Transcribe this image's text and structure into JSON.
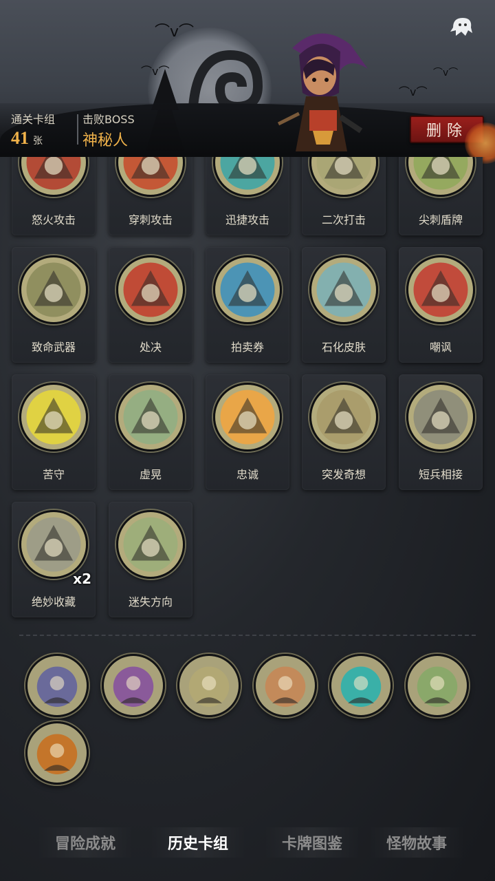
{
  "header": {
    "cleared_deck_label": "通关卡组",
    "card_count": "41",
    "card_unit": "张",
    "defeated_boss_label": "击败BOSS",
    "boss_name": "神秘人",
    "delete_label": "删除",
    "ghost_icon": "ghost-icon"
  },
  "cards": [
    {
      "name": "怒火攻击",
      "icon": "rage-axe-art",
      "color": "#b33a2a"
    },
    {
      "name": "穿刺攻击",
      "icon": "pierce-spikes-art",
      "color": "#c7492a"
    },
    {
      "name": "迅捷攻击",
      "icon": "swift-axe-art",
      "color": "#3aa5a8"
    },
    {
      "name": "二次打击",
      "icon": "double-dagger-art",
      "color": "#a8a474"
    },
    {
      "name": "尖刺盾牌",
      "icon": "spike-shield-art",
      "color": "#8fa85a"
    },
    {
      "name": "致命武器",
      "icon": "deadly-weapons-art",
      "color": "#8a8a5a"
    },
    {
      "name": "处决",
      "icon": "execute-art",
      "color": "#c23a2a"
    },
    {
      "name": "拍卖券",
      "icon": "auction-gavel-art",
      "color": "#3a8fc0"
    },
    {
      "name": "石化皮肤",
      "icon": "stone-skin-art",
      "color": "#7ab0b8"
    },
    {
      "name": "嘲讽",
      "icon": "taunt-art",
      "color": "#c33a30"
    },
    {
      "name": "苦守",
      "icon": "endure-shield-art",
      "color": "#e8d83a"
    },
    {
      "name": "虚晃",
      "icon": "feint-boxer-art",
      "color": "#8fae84"
    },
    {
      "name": "忠诚",
      "icon": "loyalty-cross-art",
      "color": "#f2a440"
    },
    {
      "name": "突发奇想",
      "icon": "sudden-idea-art",
      "color": "#a89a6a"
    },
    {
      "name": "短兵相接",
      "icon": "close-combat-art",
      "color": "#8a8a7a"
    },
    {
      "name": "绝妙收藏",
      "icon": "collection-art",
      "color": "#9a9a8a",
      "count": "x2"
    },
    {
      "name": "迷失方向",
      "icon": "lost-signpost-art",
      "color": "#9aae7a"
    }
  ],
  "relics": [
    {
      "icon": "witch-cat-icon",
      "color": "#6a6a9a"
    },
    {
      "icon": "hammer-book-icon",
      "color": "#8a5a9a"
    },
    {
      "icon": "hourglass-icon",
      "color": "#b2a874"
    },
    {
      "icon": "bearded-men-icon",
      "color": "#c38a5a"
    },
    {
      "icon": "dark-tower-icon",
      "color": "#3ab0a8"
    },
    {
      "icon": "zombies-icon",
      "color": "#8aa86a"
    },
    {
      "icon": "pumpkin-scarecrow-icon",
      "color": "#c4752a"
    }
  ],
  "tabs": [
    {
      "label": "冒险成就",
      "active": false
    },
    {
      "label": "历史卡组",
      "active": true
    },
    {
      "label": "卡牌图鉴",
      "active": false
    },
    {
      "label": "怪物故事",
      "active": false
    }
  ]
}
